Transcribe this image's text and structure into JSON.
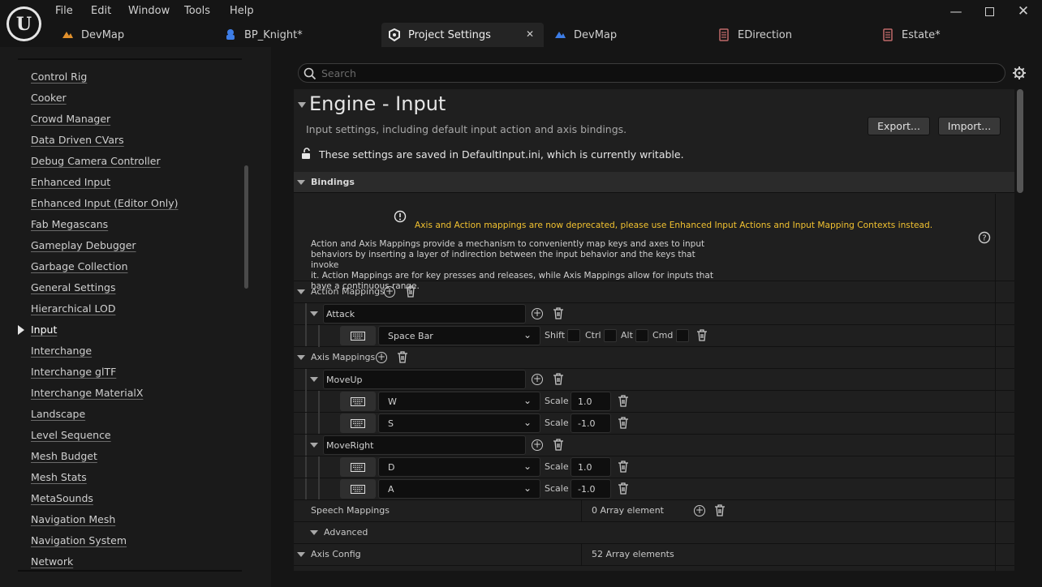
{
  "menu": [
    "File",
    "Edit",
    "Window",
    "Tools",
    "Help"
  ],
  "tabs": [
    {
      "label": "DevMap",
      "icon": "map-icon"
    },
    {
      "label": "BP_Knight*",
      "icon": "blueprint-icon"
    },
    {
      "label": "Project Settings",
      "icon": "settings-icon",
      "active": true
    },
    {
      "label": "DevMap",
      "icon": "map-icon"
    },
    {
      "label": "EDirection",
      "icon": "enum-icon"
    },
    {
      "label": "Estate*",
      "icon": "enum-icon"
    }
  ],
  "sidebar": {
    "items": [
      "Control Rig",
      "Cooker",
      "Crowd Manager",
      "Data Driven CVars",
      "Debug Camera Controller",
      "Enhanced Input",
      "Enhanced Input (Editor Only)",
      "Fab Megascans",
      "Gameplay Debugger",
      "Garbage Collection",
      "General Settings",
      "Hierarchical LOD",
      "Input",
      "Interchange",
      "Interchange glTF",
      "Interchange MaterialX",
      "Landscape",
      "Level Sequence",
      "Mesh Budget",
      "Mesh Stats",
      "MetaSounds",
      "Navigation Mesh",
      "Navigation System",
      "Network"
    ],
    "selected": "Input"
  },
  "search": {
    "placeholder": "Search"
  },
  "header": {
    "title": "Engine - Input",
    "description": "Input settings, including default input action and axis bindings.",
    "save_notice": "These settings are saved in DefaultInput.ini, which is currently writable.",
    "export_label": "Export...",
    "import_label": "Import..."
  },
  "bindings": {
    "section_label": "Bindings",
    "warning": "Axis and Action mappings are now deprecated, please use Enhanced Input Actions and Input Mapping Contexts instead.",
    "info_lines": [
      "Action and Axis Mappings provide a mechanism to conveniently map keys and axes to input",
      "behaviors by inserting a layer of indirection between the input behavior and the keys that invoke",
      "it. Action Mappings are for key presses and releases, while Axis Mappings allow for inputs that",
      "have a continuous range."
    ],
    "action_mappings_label": "Action Mappings",
    "action": {
      "name": "Attack",
      "key": "Space Bar",
      "modifiers": [
        "Shift",
        "Ctrl",
        "Alt",
        "Cmd"
      ]
    },
    "axis_mappings_label": "Axis Mappings",
    "scale_label": "Scale",
    "axes": [
      {
        "name": "MoveUp",
        "keys": [
          {
            "key": "W",
            "scale": "1.0"
          },
          {
            "key": "S",
            "scale": "-1.0"
          }
        ]
      },
      {
        "name": "MoveRight",
        "keys": [
          {
            "key": "D",
            "scale": "1.0"
          },
          {
            "key": "A",
            "scale": "-1.0"
          }
        ]
      }
    ],
    "speech_label": "Speech Mappings",
    "speech_value": "0 Array element",
    "advanced_label": "Advanced",
    "axis_config_label": "Axis Config",
    "axis_config_value": "52 Array elements"
  }
}
